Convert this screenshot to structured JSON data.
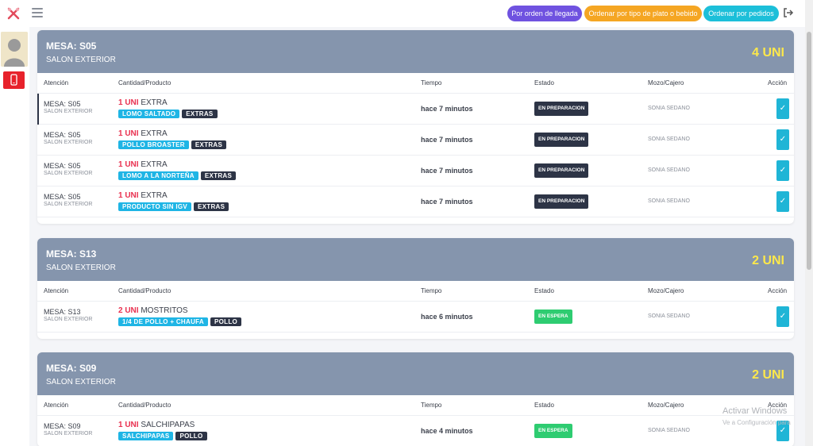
{
  "topbar": {
    "buttons": [
      {
        "label": "Por orden de llegada",
        "color": "#6f52e0"
      },
      {
        "label": "Ordenar por tipo de plato o bebido",
        "color": "#f5a623"
      },
      {
        "label": "Ordenar por pedidos",
        "color": "#1cbfd9"
      }
    ]
  },
  "table_headers": [
    "Atención",
    "Cantidad/Producto",
    "Tiempo",
    "Estado",
    "Mozo/Cajero",
    "Acción"
  ],
  "orders": [
    {
      "title": "MESA: S05",
      "zone": "SALON EXTERIOR",
      "count": "4 UNI",
      "rows": [
        {
          "mesa": "MESA: S05",
          "zona": "SALON EXTERIOR",
          "qty": "1 UNI",
          "category": "EXTRA",
          "product": "LOMO SALTADO",
          "type": "EXTRAS",
          "time": "hace 7 minutos",
          "state": "EN PREPARACION",
          "mozo": "SONIA SEDANO"
        },
        {
          "mesa": "MESA: S05",
          "zona": "SALON EXTERIOR",
          "qty": "1 UNI",
          "category": "EXTRA",
          "product": "POLLO BROASTER",
          "type": "EXTRAS",
          "time": "hace 7 minutos",
          "state": "EN PREPARACION",
          "mozo": "SONIA SEDANO"
        },
        {
          "mesa": "MESA: S05",
          "zona": "SALON EXTERIOR",
          "qty": "1 UNI",
          "category": "EXTRA",
          "product": "LOMO A LA NORTEÑA",
          "type": "EXTRAS",
          "time": "hace 7 minutos",
          "state": "EN PREPARACION",
          "mozo": "SONIA SEDANO"
        },
        {
          "mesa": "MESA: S05",
          "zona": "SALON EXTERIOR",
          "qty": "1 UNI",
          "category": "EXTRA",
          "product": "PRODUCTO SIN IGV",
          "type": "EXTRAS",
          "time": "hace 7 minutos",
          "state": "EN PREPARACION",
          "mozo": "SONIA SEDANO"
        }
      ]
    },
    {
      "title": "MESA: S13",
      "zone": "SALON EXTERIOR",
      "count": "2 UNI",
      "rows": [
        {
          "mesa": "MESA: S13",
          "zona": "SALON EXTERIOR",
          "qty": "2 UNI",
          "category": "MOSTRITOS",
          "product": "1/4 DE POLLO + CHAUFA",
          "type": "POLLO",
          "time": "hace 6 minutos",
          "state": "EN ESPERA",
          "mozo": "SONIA SEDANO"
        }
      ]
    },
    {
      "title": "MESA: S09",
      "zone": "SALON EXTERIOR",
      "count": "2 UNI",
      "rows": [
        {
          "mesa": "MESA: S09",
          "zona": "SALON EXTERIOR",
          "qty": "1 UNI",
          "category": "SALCHIPAPAS",
          "product": "SALCHIPAPAS",
          "type": "POLLO",
          "time": "hace 4 minutos",
          "state": "EN ESPERA",
          "mozo": "SONIA SEDANO"
        }
      ]
    }
  ],
  "watermark": {
    "line1": "Activar Windows",
    "line2": "Ve a Configuración para"
  },
  "colors": {
    "header": "#8595ad",
    "accent": "#1fb5e5",
    "qty": "#e9304f",
    "count": "#fde84b",
    "prep": "#2d3446",
    "wait": "#2ecc71"
  }
}
